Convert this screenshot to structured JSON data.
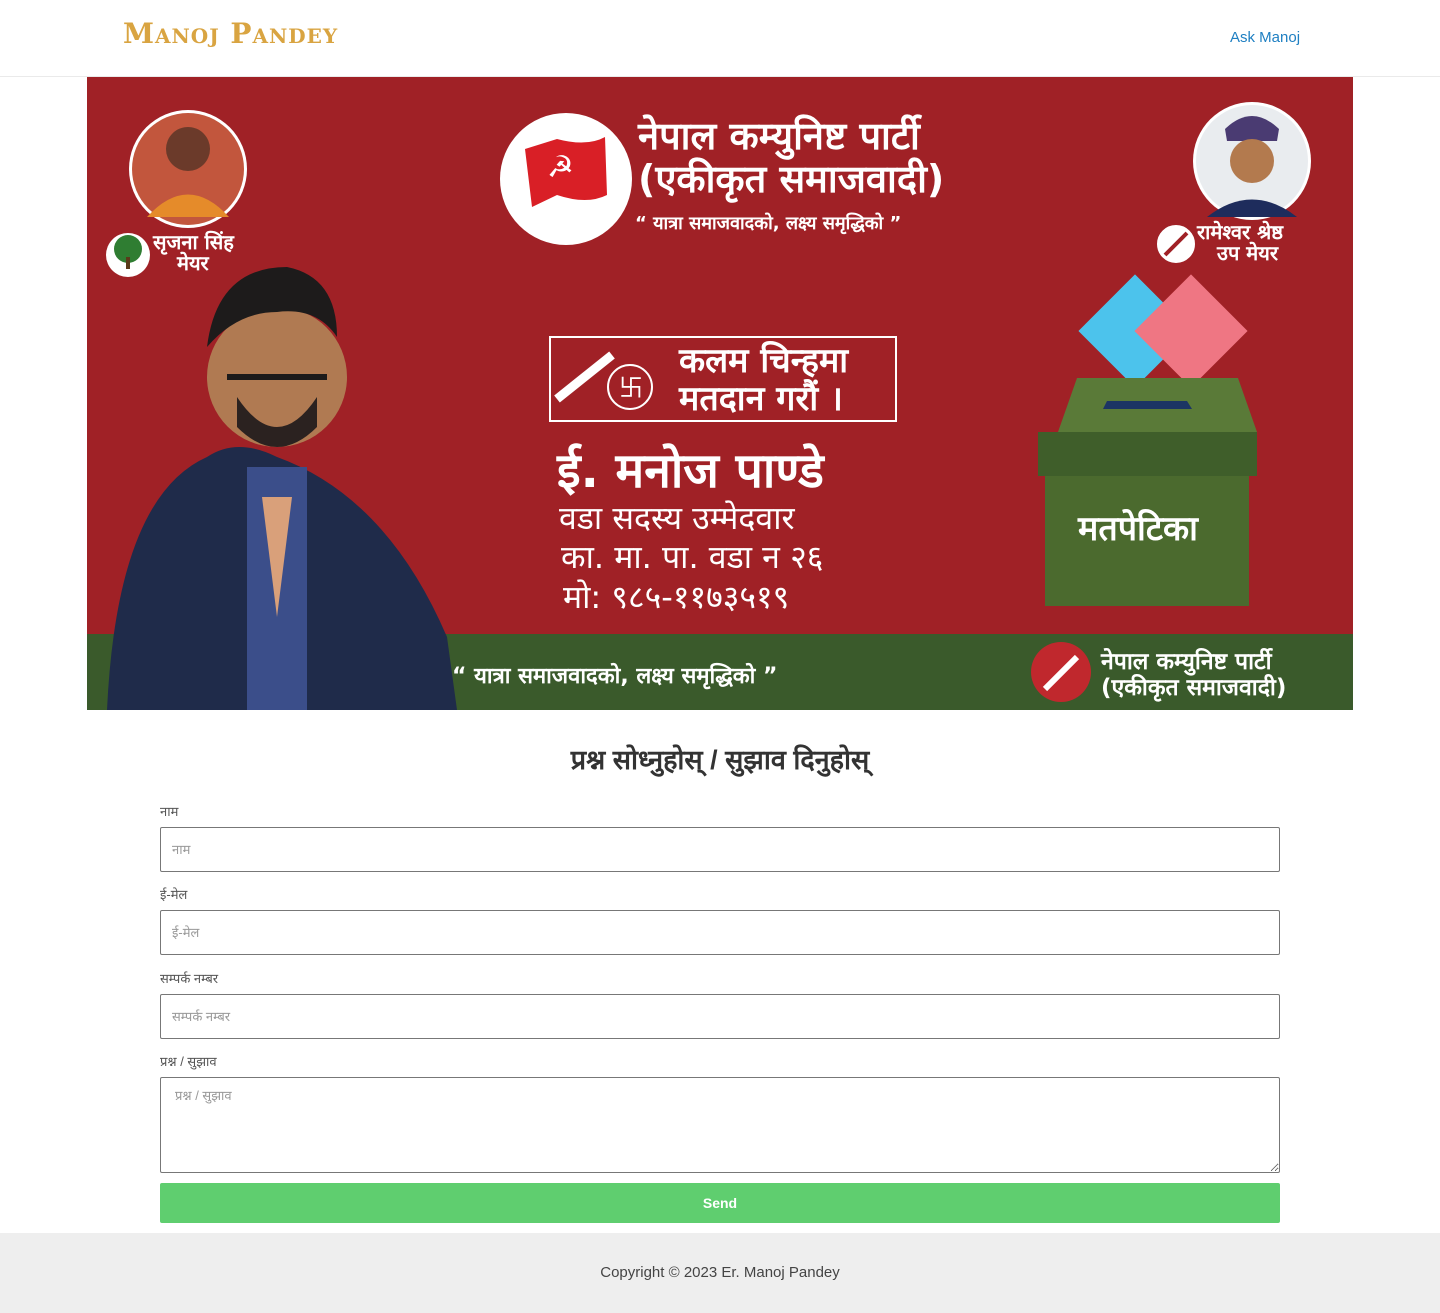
{
  "header": {
    "logo": "Manoj Pandey",
    "nav_link": "Ask Manoj"
  },
  "banner": {
    "party_name_line1": "नेपाल कम्युनिष्ट पार्टी",
    "party_name_line2": "(एकीकृत समाजवादी)",
    "slogan": "“ यात्रा समाजवादको, लक्ष्य समृद्धिको ”",
    "mayor_name": "सृजना सिंह",
    "mayor_title": "मेयर",
    "deputy_name": "रामेश्वर श्रेष्ठ",
    "deputy_title": "उप मेयर",
    "vote_line1": "कलम चिन्हमा",
    "vote_line2": "मतदान गरौं ।",
    "candidate_name": "ई. मनोज पाण्डे",
    "candidate_role": "वडा सदस्य उम्मेदवार",
    "candidate_ward": "का. मा. पा. वडा न २६",
    "candidate_phone": "मो: ९८५-११७३५१९",
    "ballot_box_label": "मतपेटिका",
    "footer_slogan": "“ यात्रा समाजवादको, लक्ष्य समृद्धिको ”",
    "footer_party_line1": "नेपाल कम्युनिष्ट पार्टी",
    "footer_party_line2": "(एकीकृत समाजवादी)",
    "colors": {
      "red": "#a02126",
      "green": "#3a5a2b",
      "ballot_blue": "#4cc3ec",
      "ballot_pink": "#ef7683",
      "box_green": "#4b6a2e"
    }
  },
  "form": {
    "title": "प्रश्न सोध्नुहोस् / सुझाव दिनुहोस्",
    "name_label": "नाम",
    "name_placeholder": "नाम",
    "email_label": "ई-मेल",
    "email_placeholder": "ई-मेल",
    "phone_label": "सम्पर्क नम्बर",
    "phone_placeholder": "सम्पर्क नम्बर",
    "message_label": "प्रश्न / सुझाव",
    "message_placeholder": "प्रश्न / सुझाव",
    "send_label": "Send"
  },
  "footer": {
    "copyright": "Copyright © 2023 Er. Manoj Pandey"
  }
}
